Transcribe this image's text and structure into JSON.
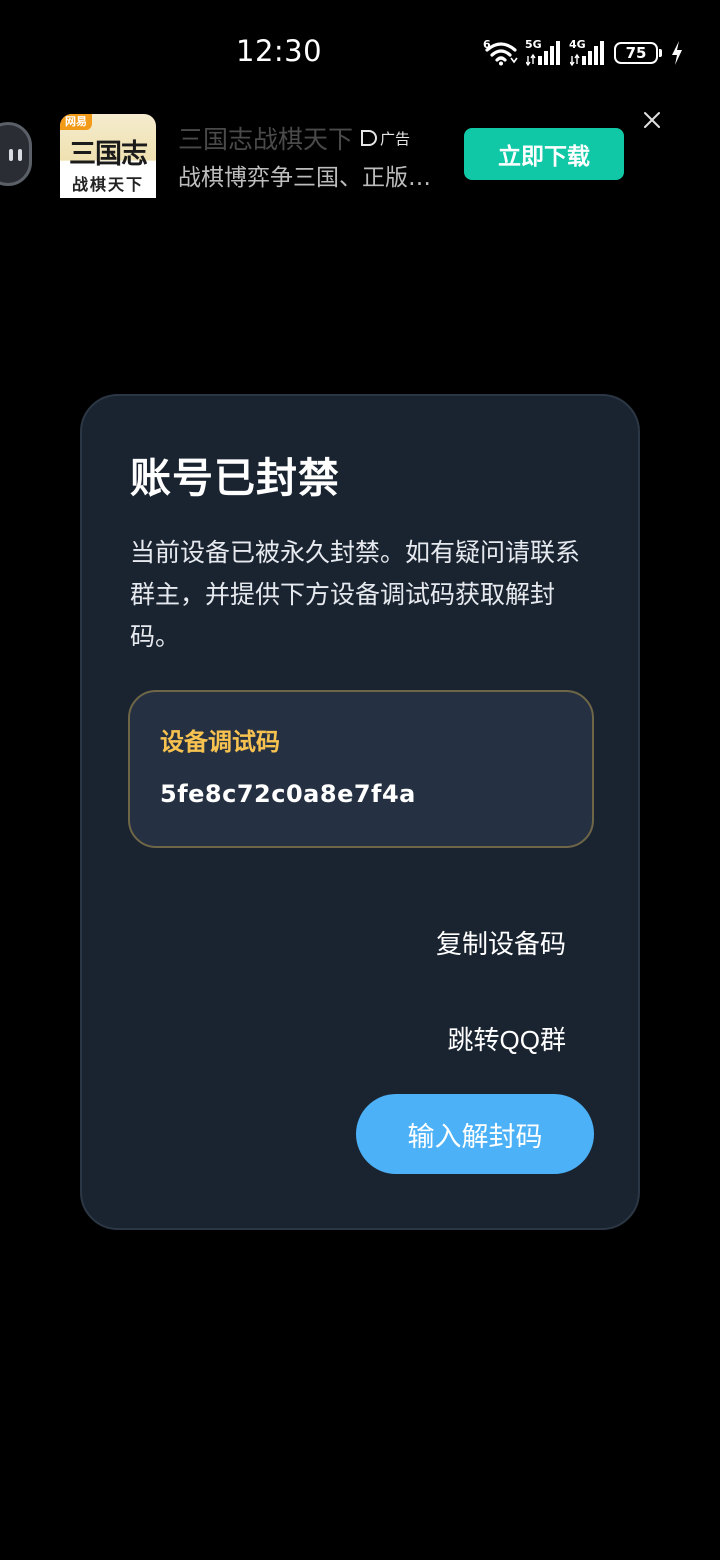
{
  "status_bar": {
    "time": "12:30",
    "wifi_label": "6",
    "signal1_label": "5G",
    "signal2_label": "4G",
    "battery": "75",
    "icons": [
      "wifi-6-icon",
      "signal-5g-icon",
      "signal-4g-icon",
      "battery-icon",
      "charging-bolt-icon"
    ]
  },
  "ad": {
    "app_icon_tag": "网易",
    "app_icon_title": "三国志",
    "app_icon_subtitle": "战棋天下",
    "title": "三国志战棋天下",
    "badge": "广告",
    "description": "战棋博弈争三国、正版…",
    "cta": "立即下载",
    "colors": {
      "cta": "#10c8a6"
    }
  },
  "dialog": {
    "title": "账号已封禁",
    "message": "当前设备已被永久封禁。如有疑问请联系群主，并提供下方设备调试码获取解封码。",
    "code_label": "设备调试码",
    "code_value": "5fe8c72c0a8e7f4a",
    "copy_button": "复制设备码",
    "qq_button": "跳转QQ群",
    "enter_code_button": "输入解封码",
    "colors": {
      "background": "#1a2431",
      "code_label": "#f7c24f",
      "primary_button": "#4cb1f7"
    }
  }
}
